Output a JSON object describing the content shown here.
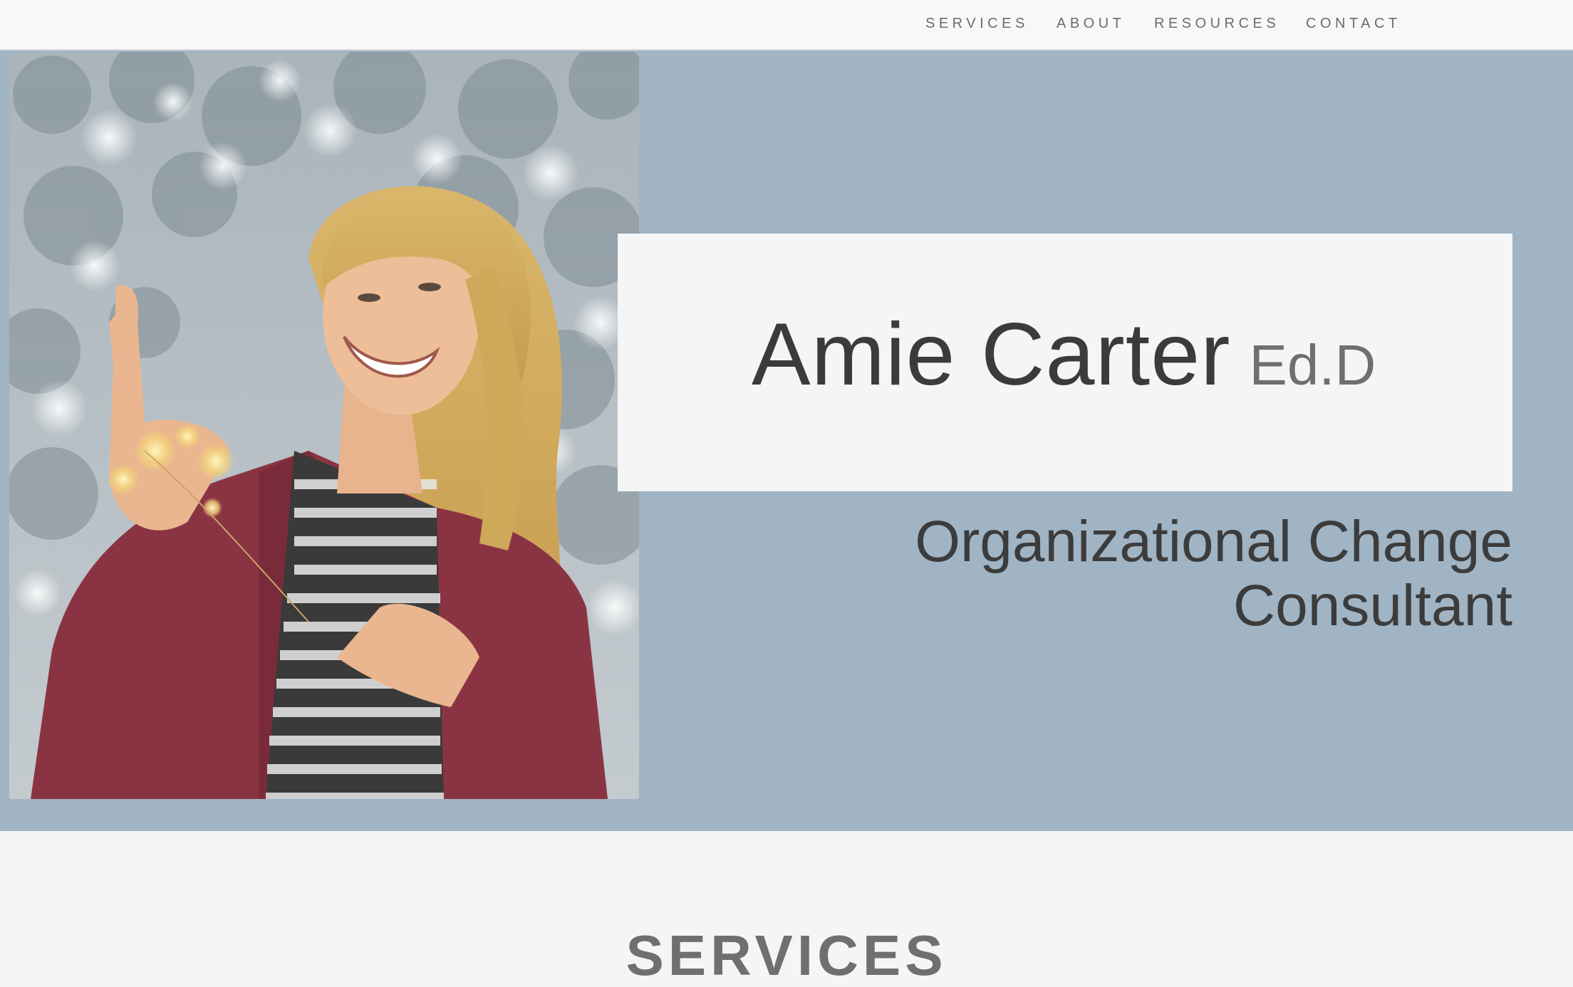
{
  "nav": {
    "items": [
      {
        "label": "SERVICES"
      },
      {
        "label": "ABOUT"
      },
      {
        "label": "RESOURCES"
      },
      {
        "label": "CONTACT"
      }
    ]
  },
  "hero": {
    "name": "Amie Carter",
    "credential": "Ed.D",
    "tagline_line1": "Organizational Change",
    "tagline_line2": "Consultant",
    "photo_icon": "portrait-photo",
    "background_color": "#a0b4c4"
  },
  "services": {
    "heading": "SERVICES"
  }
}
